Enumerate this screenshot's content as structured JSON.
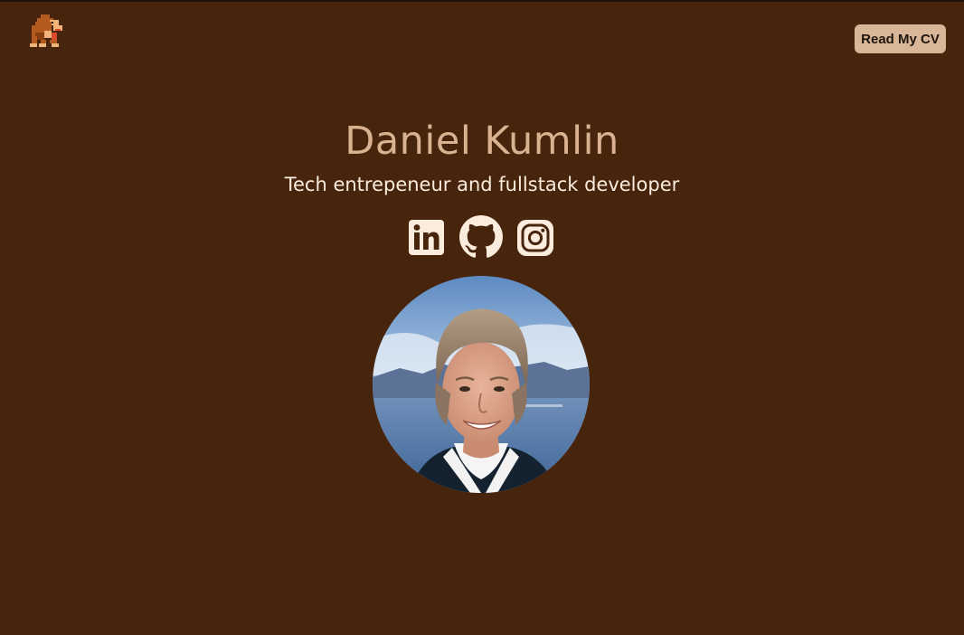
{
  "header": {
    "logo_icon": "pixel-ape-icon",
    "cv_button_label": "Read My CV"
  },
  "hero": {
    "name": "Daniel Kumlin",
    "tagline": "Tech entrepeneur and fullstack developer"
  },
  "socials": [
    {
      "icon": "linkedin-icon"
    },
    {
      "icon": "github-icon"
    },
    {
      "icon": "instagram-icon"
    }
  ],
  "colors": {
    "background": "#47240c",
    "title": "#d9b391",
    "tagline": "#fbecdd",
    "button": "#d8b697",
    "icons": "#fbecdd"
  }
}
